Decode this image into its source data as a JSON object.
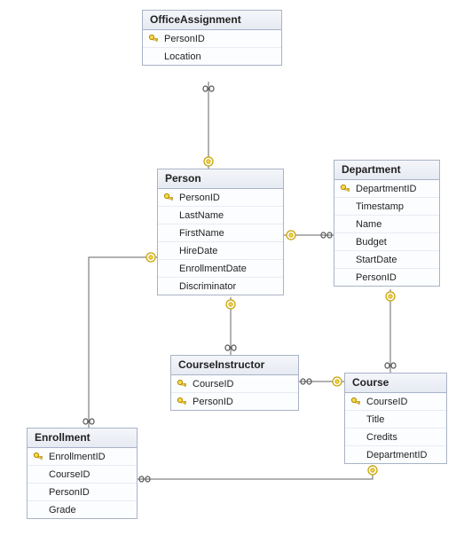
{
  "entities": {
    "officeAssignment": {
      "title": "OfficeAssignment",
      "columns": [
        {
          "name": "PersonID",
          "pk": true
        },
        {
          "name": "Location",
          "pk": false
        }
      ]
    },
    "person": {
      "title": "Person",
      "columns": [
        {
          "name": "PersonID",
          "pk": true
        },
        {
          "name": "LastName",
          "pk": false
        },
        {
          "name": "FirstName",
          "pk": false
        },
        {
          "name": "HireDate",
          "pk": false
        },
        {
          "name": "EnrollmentDate",
          "pk": false
        },
        {
          "name": "Discriminator",
          "pk": false
        }
      ]
    },
    "department": {
      "title": "Department",
      "columns": [
        {
          "name": "DepartmentID",
          "pk": true
        },
        {
          "name": "Timestamp",
          "pk": false
        },
        {
          "name": "Name",
          "pk": false
        },
        {
          "name": "Budget",
          "pk": false
        },
        {
          "name": "StartDate",
          "pk": false
        },
        {
          "name": "PersonID",
          "pk": false
        }
      ]
    },
    "courseInstructor": {
      "title": "CourseInstructor",
      "columns": [
        {
          "name": "CourseID",
          "pk": true
        },
        {
          "name": "PersonID",
          "pk": true
        }
      ]
    },
    "course": {
      "title": "Course",
      "columns": [
        {
          "name": "CourseID",
          "pk": true
        },
        {
          "name": "Title",
          "pk": false
        },
        {
          "name": "Credits",
          "pk": false
        },
        {
          "name": "DepartmentID",
          "pk": false
        }
      ]
    },
    "enrollment": {
      "title": "Enrollment",
      "columns": [
        {
          "name": "EnrollmentID",
          "pk": true
        },
        {
          "name": "CourseID",
          "pk": false
        },
        {
          "name": "PersonID",
          "pk": false
        },
        {
          "name": "Grade",
          "pk": false
        }
      ]
    }
  },
  "relationships": [
    {
      "from": "OfficeAssignment",
      "to": "Person"
    },
    {
      "from": "Person",
      "to": "Department"
    },
    {
      "from": "Person",
      "to": "CourseInstructor"
    },
    {
      "from": "CourseInstructor",
      "to": "Course"
    },
    {
      "from": "Department",
      "to": "Course"
    },
    {
      "from": "Course",
      "to": "Enrollment"
    },
    {
      "from": "Person",
      "to": "Enrollment"
    }
  ]
}
